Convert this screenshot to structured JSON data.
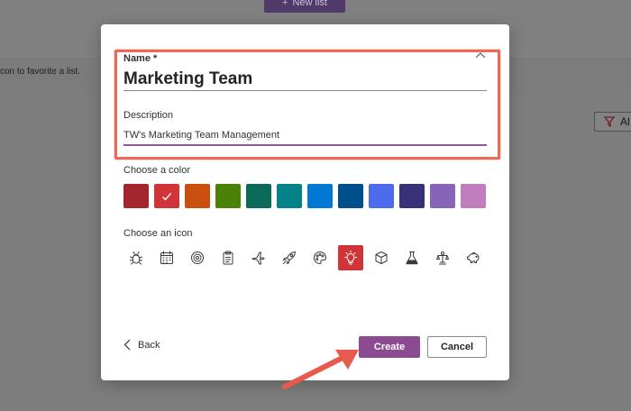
{
  "background": {
    "new_list_label": "New list",
    "favorite_hint": "con to favorite a list.",
    "filter_label": "Al"
  },
  "dialog": {
    "name_label": "Name *",
    "name_value": "Marketing Team",
    "description_label": "Description",
    "description_value": "TW's Marketing Team Management",
    "color_label": "Choose a color",
    "colors": [
      "#a4262c",
      "#d13438",
      "#ca5010",
      "#498205",
      "#0b6a5a",
      "#038387",
      "#0078d4",
      "#004e8c",
      "#4f6bed",
      "#373277",
      "#8764b8",
      "#c17dbe"
    ],
    "selected_color_index": 1,
    "icon_label": "Choose an icon",
    "icons": [
      "bug-icon",
      "calendar-icon",
      "target-icon",
      "clipboard-icon",
      "airplane-icon",
      "rocket-icon",
      "palette-icon",
      "lightbulb-icon",
      "cube-icon",
      "flask-icon",
      "balance-icon",
      "piggy-bank-icon"
    ],
    "selected_icon_index": 7,
    "back_label": "Back",
    "create_label": "Create",
    "cancel_label": "Cancel"
  },
  "colors": {
    "accent": "#8c4b91",
    "highlight": "#e96a5b",
    "selected": "#d13438"
  }
}
